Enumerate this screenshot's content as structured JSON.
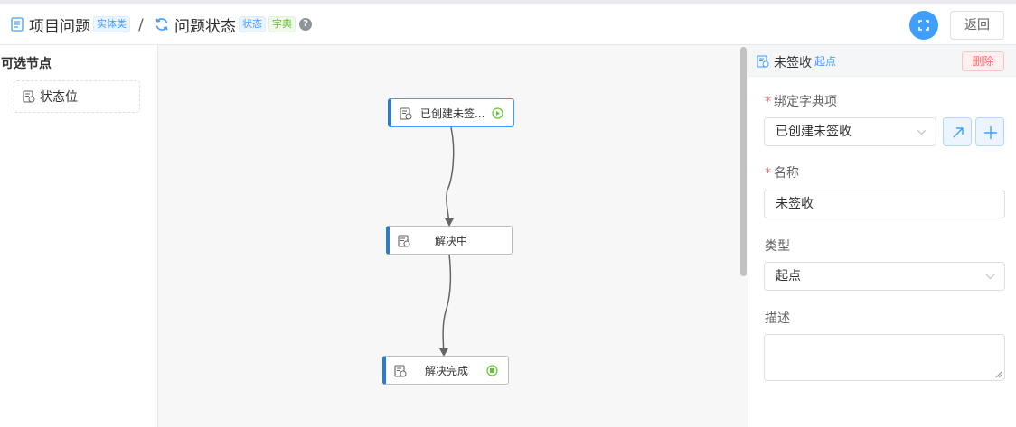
{
  "breadcrumb": {
    "entity_title": "项目问题",
    "entity_tag": "实体类",
    "separator": "/",
    "status_title": "问题状态",
    "status_tag": "状态",
    "dict_tag": "字典",
    "help": "?"
  },
  "header": {
    "back_label": "返回"
  },
  "palette": {
    "title": "可选节点",
    "items": [
      {
        "label": "状态位"
      }
    ]
  },
  "nodes": [
    {
      "label": "已创建未签...",
      "state": "start"
    },
    {
      "label": "解决中"
    },
    {
      "label": "解决完成",
      "state": "end"
    }
  ],
  "panel": {
    "title": "未签收",
    "tag": "起点",
    "delete_label": "删除",
    "dict_label": "绑定字典项",
    "dict_value": "已创建未签收",
    "name_label": "名称",
    "name_value": "未签收",
    "type_label": "类型",
    "type_value": "起点",
    "desc_label": "描述",
    "desc_value": "",
    "required_mark": "*"
  },
  "colors": {
    "primary": "#409eff",
    "node_accent": "#2b7bd6",
    "start_green": "#67c23a",
    "danger": "#f56c6c"
  }
}
